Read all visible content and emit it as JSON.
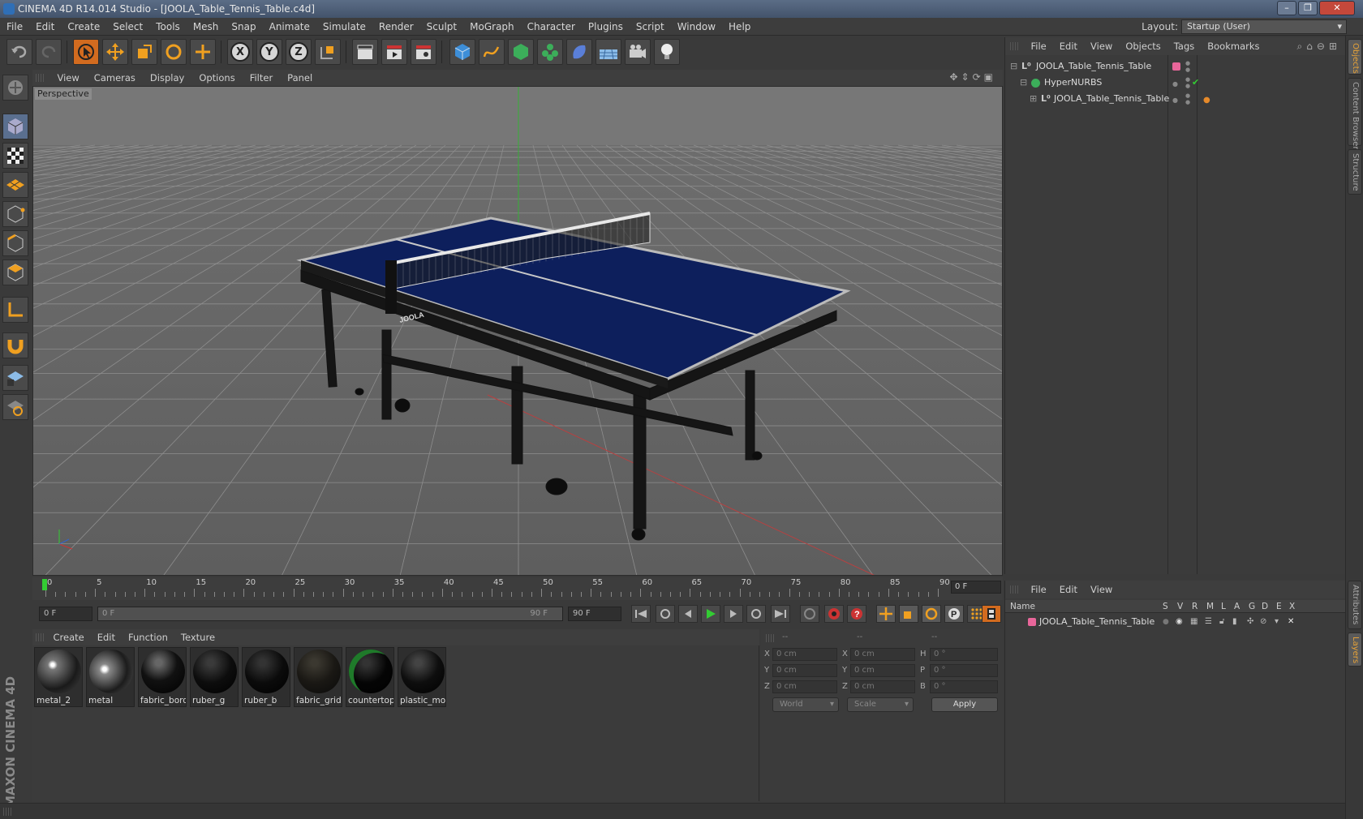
{
  "window": {
    "title": "CINEMA 4D R14.014 Studio - [JOOLA_Table_Tennis_Table.c4d]"
  },
  "menubar": {
    "items": [
      "File",
      "Edit",
      "Create",
      "Select",
      "Tools",
      "Mesh",
      "Snap",
      "Animate",
      "Simulate",
      "Render",
      "Sculpt",
      "MoGraph",
      "Character",
      "Plugins",
      "Script",
      "Window",
      "Help"
    ]
  },
  "layout": {
    "label": "Layout:",
    "value": "Startup (User)"
  },
  "toolbar": {
    "axis_x": "X",
    "axis_y": "Y",
    "axis_z": "Z"
  },
  "viewport": {
    "menu": [
      "View",
      "Cameras",
      "Display",
      "Options",
      "Filter",
      "Panel"
    ],
    "label": "Perspective",
    "table_brand": "JOOLA"
  },
  "timeline": {
    "ticks": [
      "0",
      "5",
      "10",
      "15",
      "20",
      "25",
      "30",
      "35",
      "40",
      "45",
      "50",
      "55",
      "60",
      "65",
      "70",
      "75",
      "80",
      "85",
      "90"
    ],
    "current_frame": "0 F"
  },
  "playback": {
    "start_field": "0 F",
    "range_left": "0 F",
    "range_right": "90 F",
    "end_field": "90 F"
  },
  "materials": {
    "menu": [
      "Create",
      "Edit",
      "Function",
      "Texture"
    ],
    "items": [
      {
        "name": "metal_2"
      },
      {
        "name": "metal"
      },
      {
        "name": "fabric_bord"
      },
      {
        "name": "ruber_g"
      },
      {
        "name": "ruber_b"
      },
      {
        "name": "fabric_grid"
      },
      {
        "name": "countertop"
      },
      {
        "name": "plastic_mol"
      }
    ]
  },
  "coordinates": {
    "header": [
      "--",
      "--",
      "--"
    ],
    "rows": [
      {
        "l1": "X",
        "v1": "0 cm",
        "l2": "X",
        "v2": "0 cm",
        "l3": "H",
        "v3": "0 °"
      },
      {
        "l1": "Y",
        "v1": "0 cm",
        "l2": "Y",
        "v2": "0 cm",
        "l3": "P",
        "v3": "0 °"
      },
      {
        "l1": "Z",
        "v1": "0 cm",
        "l2": "Z",
        "v2": "0 cm",
        "l3": "B",
        "v3": "0 °"
      }
    ],
    "world": "World",
    "scale": "Scale",
    "apply": "Apply"
  },
  "objects": {
    "menu": [
      "File",
      "Edit",
      "View",
      "Objects",
      "Tags",
      "Bookmarks"
    ],
    "rows": [
      "JOOLA_Table_Tennis_Table",
      "HyperNURBS",
      "JOOLA_Table_Tennis_Table"
    ]
  },
  "layers": {
    "menu": [
      "File",
      "Edit",
      "View"
    ],
    "columns": [
      "Name",
      "S",
      "V",
      "R",
      "M",
      "L",
      "A",
      "G",
      "D",
      "E",
      "X"
    ],
    "rows": [
      "JOOLA_Table_Tennis_Table"
    ]
  },
  "sidetabs": [
    "Objects",
    "Content Browser",
    "Structure",
    "Attributes",
    "Layers"
  ],
  "branding": {
    "logo": "MAXON CINEMA 4D"
  },
  "colors": {
    "accent": "#d26b1f",
    "table_blue": "#0d1f5c",
    "layer_pink": "#e8669a"
  }
}
